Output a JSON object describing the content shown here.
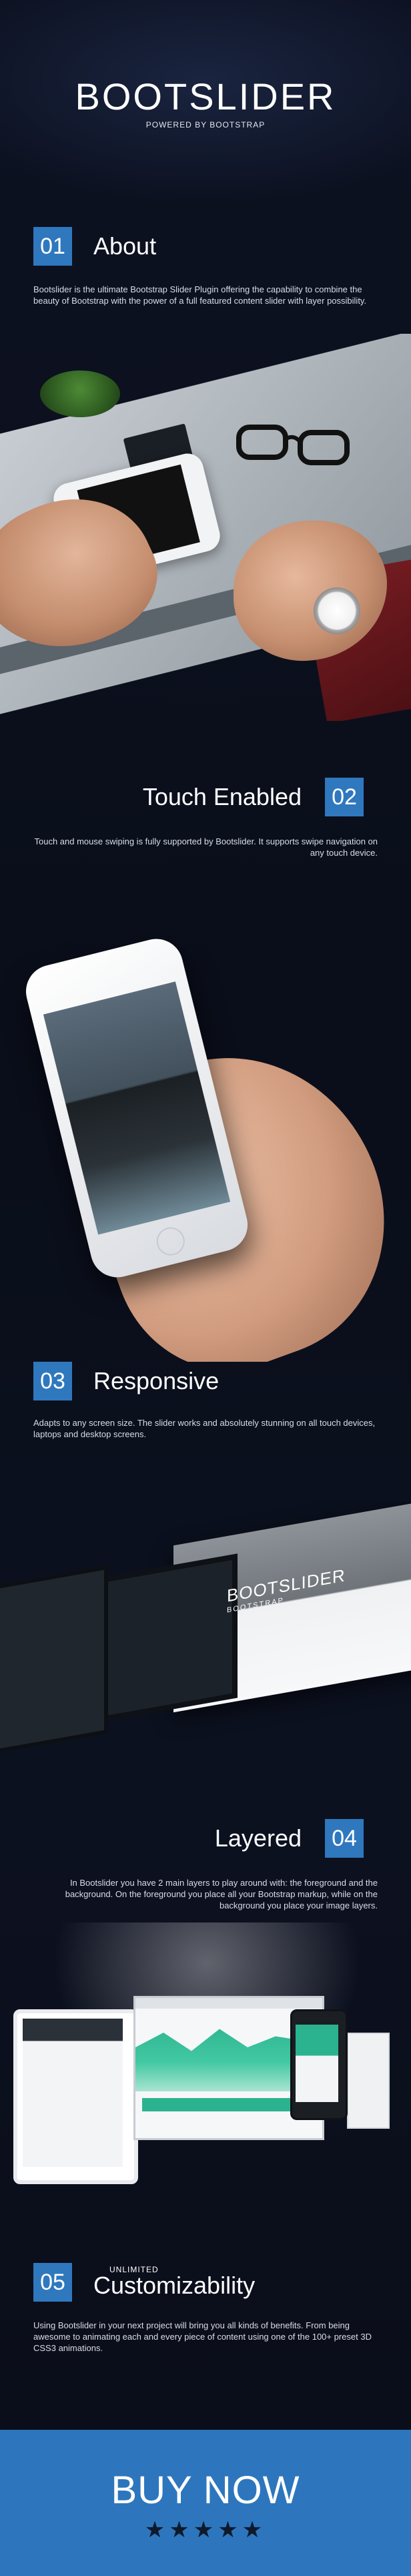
{
  "header": {
    "title": "BOOTSLIDER",
    "subtitle": "POWERED BY BOOTSTRAP"
  },
  "sections": [
    {
      "num": "01",
      "title": "About",
      "text": "Bootslider is the ultimate Bootstrap Slider Plugin offering the capability to combine the beauty of Bootstrap with the power of a full featured content slider with layer possibility."
    },
    {
      "num": "02",
      "title": "Touch Enabled",
      "text": "Touch and mouse swiping is fully supported by Bootslider. It supports swipe navigation on any touch device."
    },
    {
      "num": "03",
      "title": "Responsive",
      "text": "Adapts to any screen size. The slider works and absolutely stunning on all touch devices, laptops and desktop screens."
    },
    {
      "num": "04",
      "title": "Layered",
      "text": "In Bootslider you have 2 main layers to play around with: the foreground and the background. On the foreground you place all your Bootstrap markup, while on the background  you place your image layers."
    },
    {
      "num": "05",
      "title": "Customizability",
      "kicker": "UNLIMITED",
      "text": "Using Bootslider in your next project will bring you all kinds of benefits. From being awesome to animating each and every piece of content using one of the 100+ preset 3D CSS3 animations."
    }
  ],
  "responsive_mock": {
    "title": "BOOTSLIDER",
    "subtitle": "BOOTSTRAP"
  },
  "cta": {
    "label": "BUY NOW",
    "stars": "★★★★★",
    "rating": 5
  },
  "colors": {
    "accent": "#2f78be",
    "background": "#0b0f1c"
  }
}
